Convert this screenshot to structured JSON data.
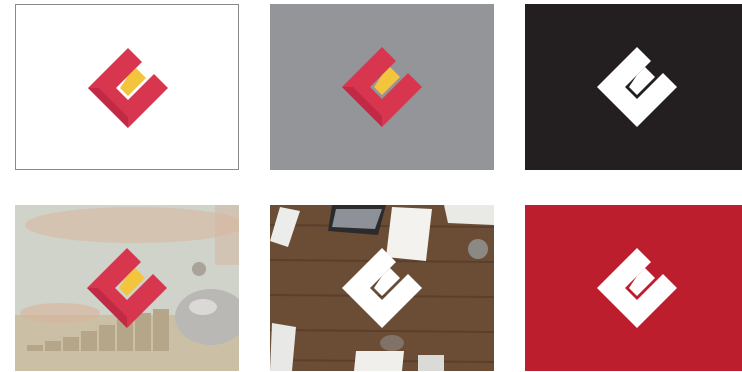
{
  "colors": {
    "logo_red": "#d8354e",
    "logo_red_dark": "#c02a45",
    "logo_yellow": "#f2c53d",
    "logo_white": "#ffffff",
    "bg_white": "#ffffff",
    "bg_gray": "#949598",
    "bg_black": "#231f20",
    "bg_red": "#bd1e2d"
  },
  "tiles": [
    {
      "background": "white",
      "logo_style": "color"
    },
    {
      "background": "gray",
      "logo_style": "color"
    },
    {
      "background": "black",
      "logo_style": "white"
    },
    {
      "background": "photo-piggy-bank-coins",
      "logo_style": "color"
    },
    {
      "background": "photo-wooden-desk-laptop",
      "logo_style": "white"
    },
    {
      "background": "red",
      "logo_style": "white"
    }
  ]
}
